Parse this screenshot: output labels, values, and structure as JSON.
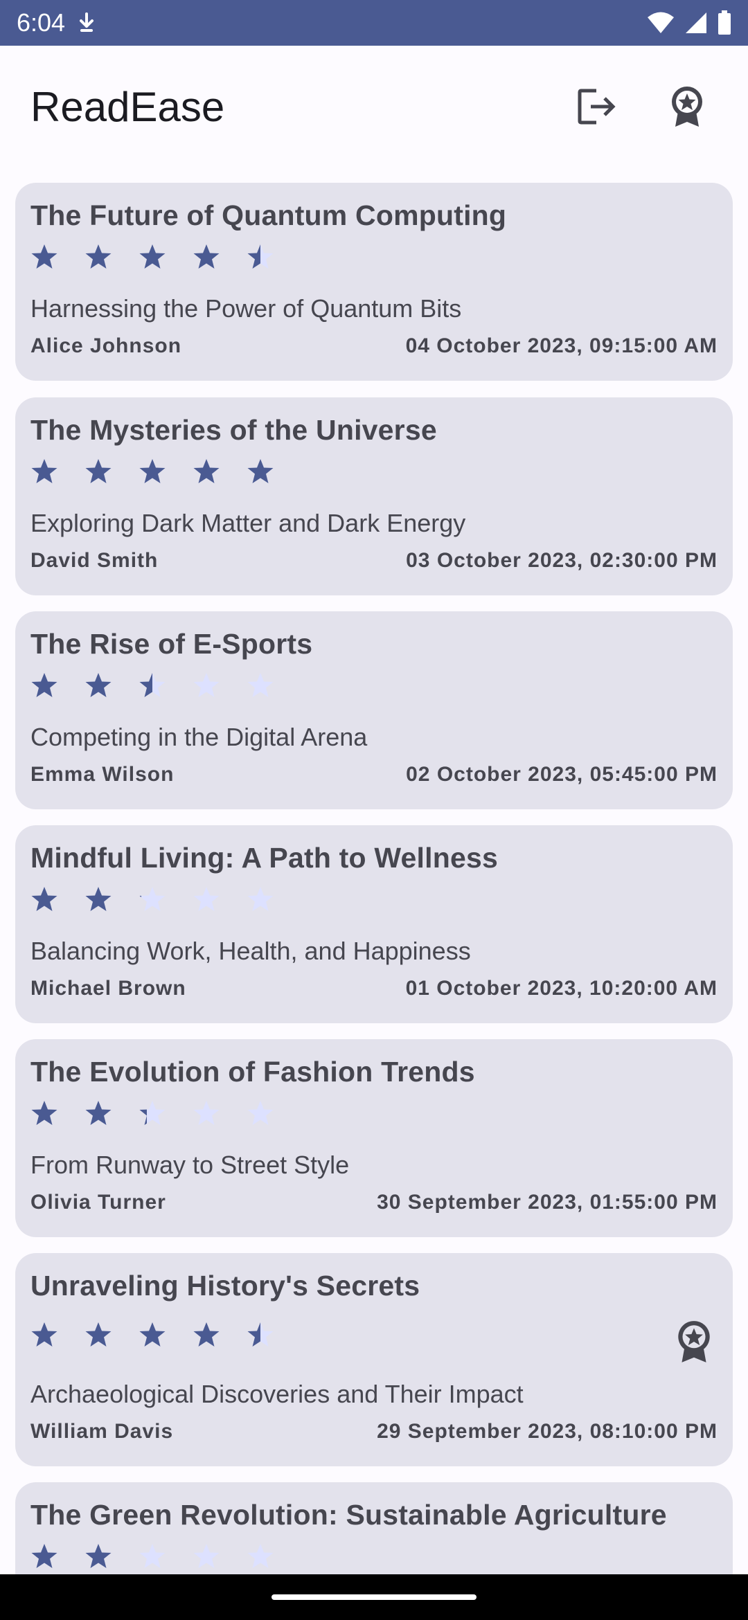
{
  "status_bar": {
    "time": "6:04",
    "icons": [
      "download-status-icon",
      "wifi-icon",
      "cellular-signal-icon",
      "battery-icon"
    ]
  },
  "app_bar": {
    "title": "ReadEase",
    "actions": [
      "logout-icon",
      "award-badge-icon"
    ]
  },
  "colors": {
    "primary": "#4a5a92",
    "star_filled": "#4a5a92",
    "star_empty": "#dde1ff",
    "card_bg": "#e3e2ec",
    "text": "#46464f"
  },
  "articles": [
    {
      "title": "The Future of Quantum Computing",
      "rating": 4.5,
      "subtitle": "Harnessing the Power of Quantum Bits",
      "author": "Alice Johnson",
      "date": "04 October 2023, 09:15:00 AM",
      "featured": false
    },
    {
      "title": "The Mysteries of the Universe",
      "rating": 5,
      "subtitle": "Exploring Dark Matter and Dark Energy",
      "author": "David Smith",
      "date": "03 October 2023, 02:30:00 PM",
      "featured": false
    },
    {
      "title": "The Rise of E-Sports",
      "rating": 2.5,
      "subtitle": "Competing in the Digital Arena",
      "author": "Emma Wilson",
      "date": "02 October 2023, 05:45:00 PM",
      "featured": false
    },
    {
      "title": "Mindful Living: A Path to Wellness",
      "rating": 2.1,
      "subtitle": "Balancing Work, Health, and Happiness",
      "author": "Michael Brown",
      "date": "01 October 2023, 10:20:00 AM",
      "featured": false
    },
    {
      "title": "The Evolution of Fashion Trends",
      "rating": 2.3,
      "subtitle": "From Runway to Street Style",
      "author": "Olivia Turner",
      "date": "30 September 2023, 01:55:00 PM",
      "featured": false
    },
    {
      "title": "Unraveling History's Secrets",
      "rating": 4.5,
      "subtitle": "Archaeological Discoveries and Their Impact",
      "author": "William Davis",
      "date": "29 September 2023, 08:10:00 PM",
      "featured": true
    },
    {
      "title": "The Green Revolution: Sustainable Agriculture",
      "rating": 2,
      "subtitle": "",
      "author": "",
      "date": "",
      "featured": false
    }
  ]
}
